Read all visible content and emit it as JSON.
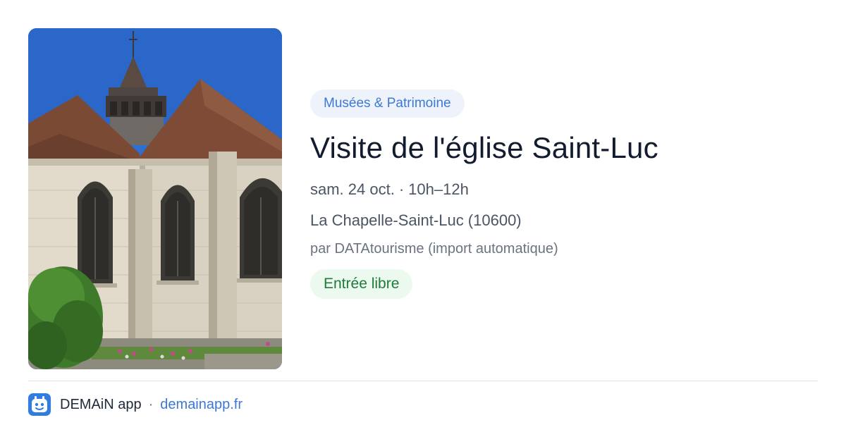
{
  "event": {
    "image_alt": "Église Saint-Luc",
    "category": "Musées & Patrimoine",
    "title": "Visite de l'église Saint-Luc",
    "date": "sam. 24 oct.",
    "time": "10h–12h",
    "date_separator": "·",
    "location": "La Chapelle-Saint-Luc (10600)",
    "organizer": "par DATAtourisme (import automatique)",
    "price": "Entrée libre"
  },
  "footer": {
    "app_name": "DEMAiN app",
    "separator": "·",
    "url": "demainapp.fr",
    "icon": "demain-app-logo-icon"
  },
  "colors": {
    "accent": "#3d78d6",
    "category_bg": "#eef3fb",
    "price_text": "#1f7a3c",
    "price_bg": "#ecf9ef",
    "title": "#131c2e"
  }
}
